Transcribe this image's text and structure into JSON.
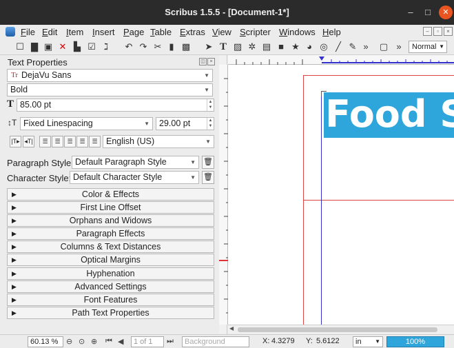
{
  "window": {
    "title": "Scribus 1.5.5 - [Document-1*]",
    "minimize": "–",
    "maximize": "□",
    "close": "✕"
  },
  "menu": [
    "File",
    "Edit",
    "Item",
    "Insert",
    "Page",
    "Table",
    "Extras",
    "View",
    "Scripter",
    "Windows",
    "Help"
  ],
  "toolbar": {
    "icons": [
      "new-document-icon",
      "open-icon",
      "save-icon",
      "close-document-icon",
      "print-icon",
      "preflight-icon",
      "pdf-icon",
      "undo-icon",
      "redo-icon",
      "cut-icon",
      "copy-icon",
      "paste-icon",
      "select-icon",
      "text-frame-icon",
      "image-frame-icon",
      "render-frame-icon",
      "table-icon",
      "shape-icon",
      "polygon-icon",
      "arc-icon",
      "spiral-icon",
      "line-icon",
      "bezier-icon",
      "more-icon",
      "preview-icon",
      "more2-icon"
    ],
    "zoom_mode": "Normal"
  },
  "text_properties": {
    "title": "Text Properties",
    "font_family": "DejaVu Sans",
    "font_style": "Bold",
    "font_size": "85.00 pt",
    "line_spacing_mode": "Fixed Linespacing",
    "line_spacing": "29.00 pt",
    "language": "English (US)",
    "paragraph_style_label": "Paragraph Style:",
    "paragraph_style": "Default Paragraph Style",
    "character_style_label": "Character Style:",
    "character_style": "Default Character Style",
    "sections": [
      "Color & Effects",
      "First Line Offset",
      "Orphans and Widows",
      "Paragraph Effects",
      "Columns & Text Distances",
      "Optical Margins",
      "Hyphenation",
      "Advanced Settings",
      "Font Features",
      "Path Text Properties"
    ]
  },
  "canvas": {
    "frame_text": "Food S"
  },
  "status": {
    "zoom": "60.13 %",
    "page": "1 of 1",
    "layer": "Background",
    "x_label": "X:",
    "x_value": "4.3279",
    "y_label": "Y:",
    "y_value": "5.6122",
    "unit": "in",
    "progress": "100%"
  }
}
